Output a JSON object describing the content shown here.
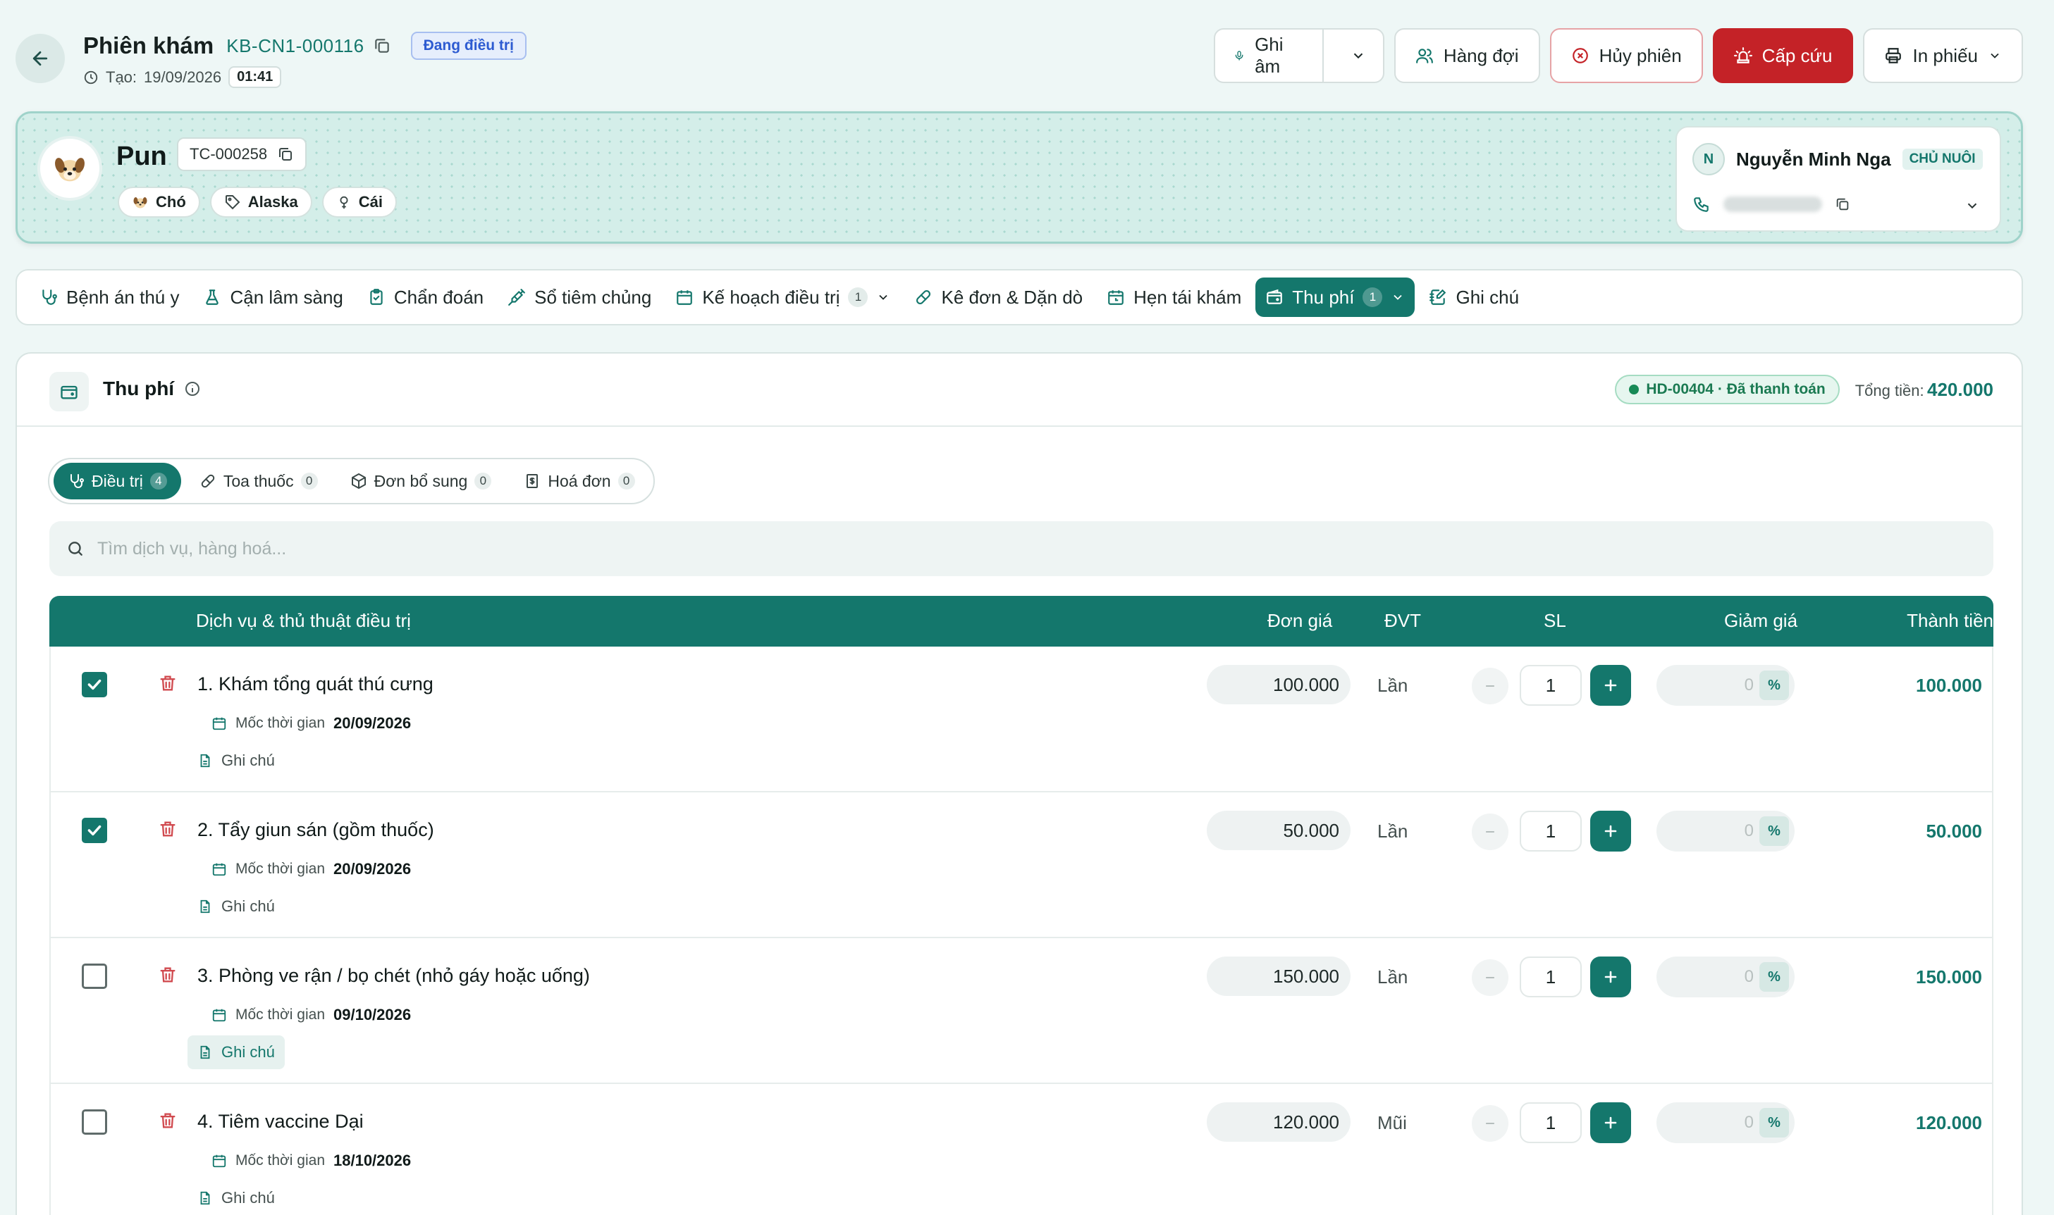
{
  "header": {
    "title": "Phiên khám",
    "session_code": "KB-CN1-000116",
    "status": "Đang điều trị",
    "created_label": "Tạo:",
    "created_date": "19/09/2026",
    "created_time": "01:41"
  },
  "actions": {
    "record": "Ghi âm",
    "queue": "Hàng đợi",
    "cancel": "Hủy phiên",
    "emergency": "Cấp cứu",
    "print": "In phiếu"
  },
  "patient": {
    "name": "Pun",
    "code": "TC-000258",
    "species": "Chó",
    "breed": "Alaska",
    "sex": "Cái"
  },
  "owner": {
    "initial": "N",
    "name": "Nguyễn Minh Nga",
    "role": "CHỦ NUÔI"
  },
  "tabs": [
    {
      "label": "Bệnh án thú y",
      "icon": "stethoscope-icon"
    },
    {
      "label": "Cận lâm sàng",
      "icon": "flask-icon"
    },
    {
      "label": "Chẩn đoán",
      "icon": "clipboard-check-icon"
    },
    {
      "label": "Sổ tiêm chủng",
      "icon": "syringe-icon"
    },
    {
      "label": "Kế hoạch điều trị",
      "icon": "calendar-icon",
      "count": "1"
    },
    {
      "label": "Kê đơn & Dặn dò",
      "icon": "pill-icon"
    },
    {
      "label": "Hẹn tái khám",
      "icon": "calendar-clock-icon"
    },
    {
      "label": "Thu phí",
      "icon": "wallet-icon",
      "count": "1",
      "active": true
    },
    {
      "label": "Ghi chú",
      "icon": "notebook-pen-icon"
    }
  ],
  "panel": {
    "title": "Thu phí",
    "invoice_badge": "HD-00404 · Đã thanh toán",
    "total_label": "Tổng tiền:",
    "total_value": "420.000"
  },
  "subtabs": [
    {
      "label": "Điều trị",
      "count": "4",
      "active": true
    },
    {
      "label": "Toa thuốc",
      "count": "0"
    },
    {
      "label": "Đơn bổ sung",
      "count": "0"
    },
    {
      "label": "Hoá đơn",
      "count": "0"
    }
  ],
  "search": {
    "placeholder": "Tìm dịch vụ, hàng hoá..."
  },
  "table": {
    "columns": {
      "service": "Dịch vụ & thủ thuật điều trị",
      "price": "Đơn giá",
      "unit": "ĐVT",
      "qty": "SL",
      "discount": "Giảm giá",
      "amount": "Thành tiền"
    },
    "milestone_label": "Mốc thời gian",
    "note_label": "Ghi chú",
    "percent_label": "%",
    "rows": [
      {
        "name": "1. Khám tổng quát thú cưng",
        "date": "20/09/2026",
        "price": "100.000",
        "unit": "Lần",
        "qty": "1",
        "discount": "0",
        "amount": "100.000",
        "checked": true
      },
      {
        "name": "2. Tẩy giun sán (gồm thuốc)",
        "date": "20/09/2026",
        "price": "50.000",
        "unit": "Lần",
        "qty": "1",
        "discount": "0",
        "amount": "50.000",
        "checked": true
      },
      {
        "name": "3. Phòng ve rận / bọ chét (nhỏ gáy hoặc uống)",
        "date": "09/10/2026",
        "price": "150.000",
        "unit": "Lần",
        "qty": "1",
        "discount": "0",
        "amount": "150.000",
        "checked": false
      },
      {
        "name": "4. Tiêm vaccine Dại",
        "date": "18/10/2026",
        "price": "120.000",
        "unit": "Mũi",
        "qty": "1",
        "discount": "0",
        "amount": "120.000",
        "checked": false
      }
    ]
  },
  "colors": {
    "primary": "#14776c",
    "danger": "#c42227",
    "status_blue": "#2d5bd1",
    "paid_green": "#1b7a52"
  }
}
